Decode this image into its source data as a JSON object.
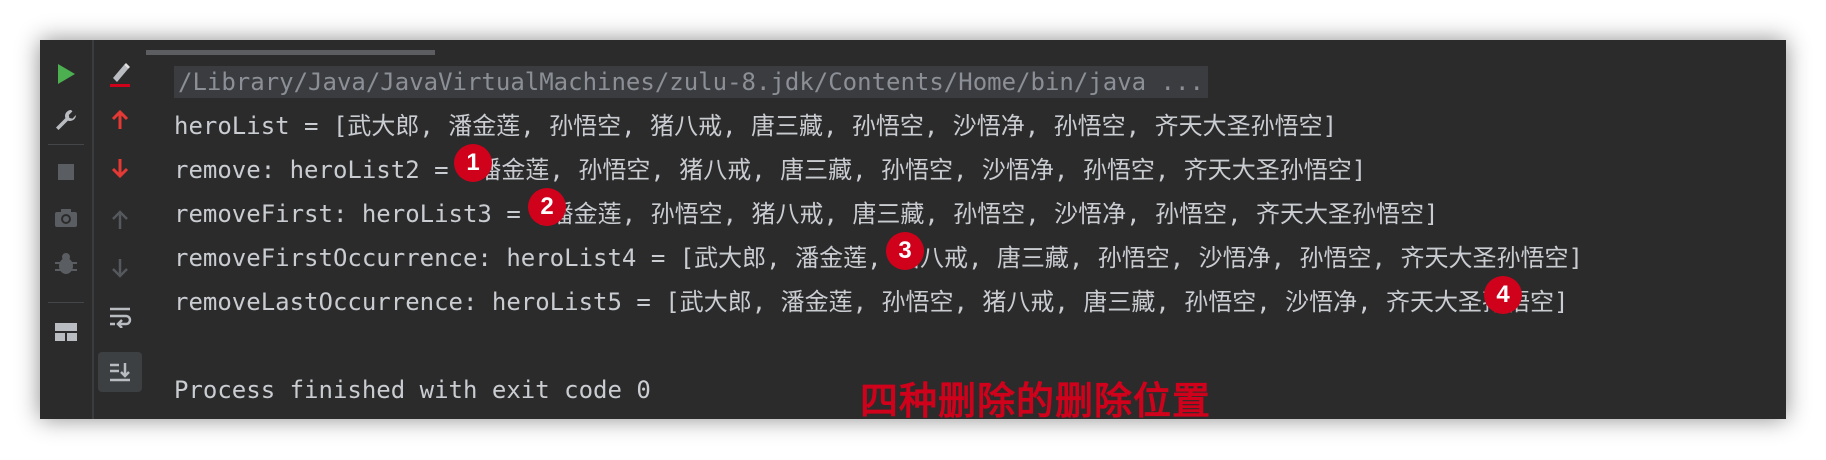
{
  "toolbar": {
    "left": [
      {
        "name": "run-icon",
        "glyph": "▶"
      },
      {
        "name": "wrench-icon",
        "glyph": "🔧"
      },
      {
        "name": "stop-icon",
        "glyph": "■"
      },
      {
        "name": "camera-icon",
        "glyph": "📷"
      },
      {
        "name": "debug-bug-icon",
        "glyph": "✱"
      },
      {
        "name": "layout-icon",
        "glyph": "▦"
      }
    ],
    "right": [
      {
        "name": "clear-icon",
        "glyph": "✎"
      },
      {
        "name": "up-arrow-icon",
        "glyph": "↑"
      },
      {
        "name": "down-arrow-icon",
        "glyph": "↓"
      },
      {
        "name": "up-arrow-disabled-icon",
        "glyph": "↑"
      },
      {
        "name": "down-arrow-disabled-icon",
        "glyph": "↓"
      },
      {
        "name": "soft-wrap-icon",
        "glyph": "⤶"
      },
      {
        "name": "scroll-to-end-icon",
        "glyph": "⇣"
      }
    ]
  },
  "console": {
    "lines": [
      "/Library/Java/JavaVirtualMachines/zulu-8.jdk/Contents/Home/bin/java ...",
      "heroList = [武大郎, 潘金莲, 孙悟空, 猪八戒, 唐三藏, 孙悟空, 沙悟净, 孙悟空, 齐天大圣孙悟空]",
      "remove: heroList2 = [潘金莲, 孙悟空, 猪八戒, 唐三藏, 孙悟空, 沙悟净, 孙悟空, 齐天大圣孙悟空]",
      "removeFirst: heroList3 = [潘金莲, 孙悟空, 猪八戒, 唐三藏, 孙悟空, 沙悟净, 孙悟空, 齐天大圣孙悟空]",
      "removeFirstOccurrence: heroList4 = [武大郎, 潘金莲, 猪八戒, 唐三藏, 孙悟空, 沙悟净, 孙悟空, 齐天大圣孙悟空]",
      "removeLastOccurrence: heroList5 = [武大郎, 潘金莲, 孙悟空, 猪八戒, 唐三藏, 孙悟空, 沙悟净, 齐天大圣孙悟空]",
      "",
      "Process finished with exit code 0"
    ]
  },
  "annotations": {
    "badges": [
      "1",
      "2",
      "3",
      "4"
    ],
    "caption": "四种删除的删除位置"
  },
  "colors": {
    "background": "#2b2b2b",
    "text": "#c9ccd1",
    "accent_red": "#d0021b",
    "run_green": "#4caf50"
  }
}
